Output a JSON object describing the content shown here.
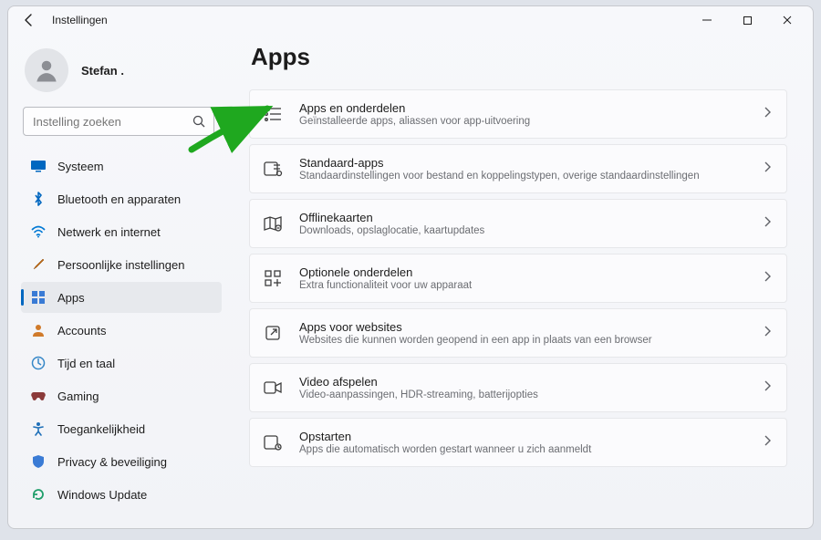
{
  "window": {
    "title": "Instellingen"
  },
  "user": {
    "name": "Stefan ."
  },
  "search": {
    "placeholder": "Instelling zoeken"
  },
  "nav": {
    "systeem": "Systeem",
    "bluetooth": "Bluetooth en apparaten",
    "netwerk": "Netwerk en internet",
    "persoonlijk": "Persoonlijke instellingen",
    "apps": "Apps",
    "accounts": "Accounts",
    "tijd": "Tijd en taal",
    "gaming": "Gaming",
    "toegank": "Toegankelijkheid",
    "privacy": "Privacy & beveiliging",
    "update": "Windows Update"
  },
  "page": {
    "title": "Apps"
  },
  "cards": {
    "c1": {
      "title": "Apps en onderdelen",
      "desc": "Geïnstalleerde apps, aliassen voor app-uitvoering"
    },
    "c2": {
      "title": "Standaard-apps",
      "desc": "Standaardinstellingen voor bestand en koppelingstypen, overige standaardinstellingen"
    },
    "c3": {
      "title": "Offlinekaarten",
      "desc": "Downloads, opslaglocatie, kaartupdates"
    },
    "c4": {
      "title": "Optionele onderdelen",
      "desc": "Extra functionaliteit voor uw apparaat"
    },
    "c5": {
      "title": "Apps voor websites",
      "desc": "Websites die kunnen worden geopend in een app in plaats van een browser"
    },
    "c6": {
      "title": "Video afspelen",
      "desc": "Video-aanpassingen, HDR-streaming, batterijopties"
    },
    "c7": {
      "title": "Opstarten",
      "desc": "Apps die automatisch worden gestart wanneer u zich aanmeldt"
    }
  }
}
